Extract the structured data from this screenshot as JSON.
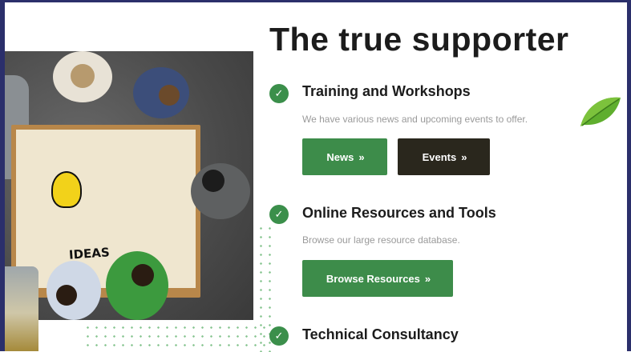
{
  "heading": "The true supporter",
  "sections": [
    {
      "title": "Training and Workshops",
      "description": "We have various news and upcoming events to offer.",
      "buttons": [
        {
          "label": "News",
          "icon": "double-chevron-right"
        },
        {
          "label": "Events",
          "icon": "double-chevron-right"
        }
      ]
    },
    {
      "title": "Online Resources and Tools",
      "description": "Browse our large resource database.",
      "buttons": [
        {
          "label": "Browse Resources",
          "icon": "double-chevron-right"
        }
      ]
    },
    {
      "title": "Technical Consultancy"
    }
  ],
  "image": {
    "label": "IDEAS"
  },
  "icons": {
    "check": "✓",
    "chevron": "»"
  },
  "colors": {
    "accent_green": "#3d8c4a",
    "dark_button": "#2a271d",
    "frame": "#2b2f6b",
    "heading": "#1c1c1c",
    "muted_text": "#9a9a9a"
  }
}
